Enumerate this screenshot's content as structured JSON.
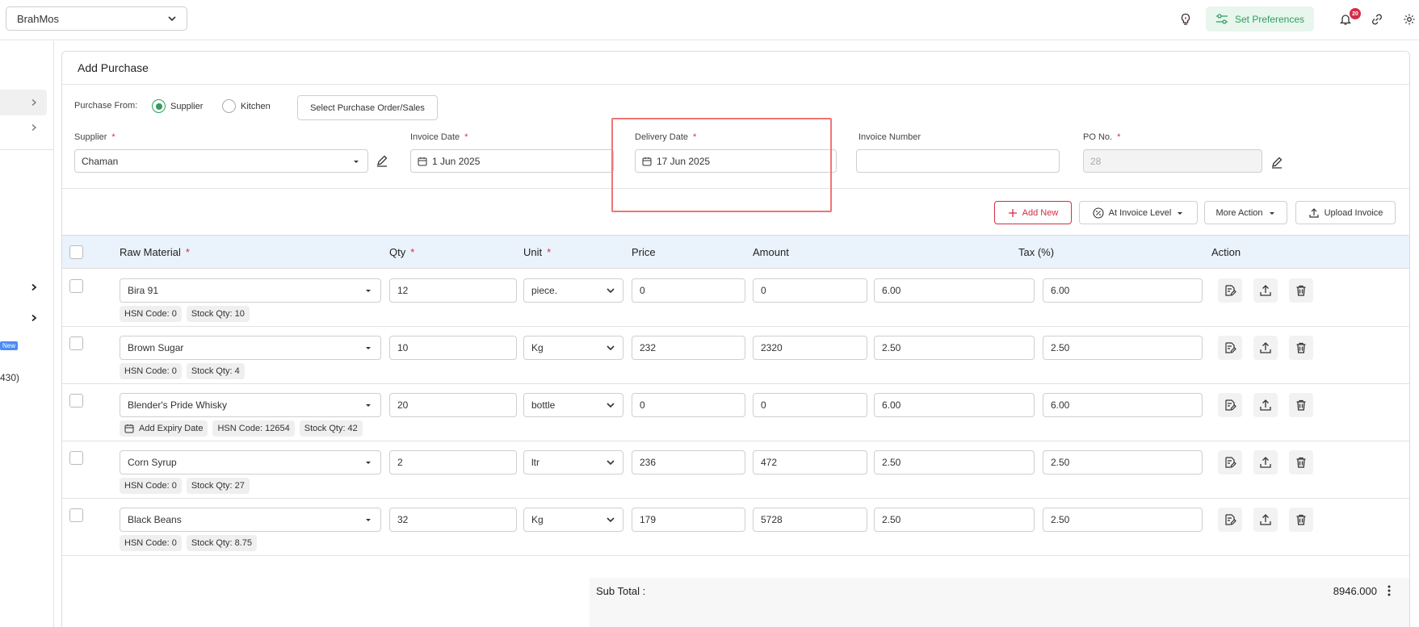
{
  "topbar": {
    "outlet": "BrahMos",
    "set_preferences": "Set Preferences",
    "notification_count": "20",
    "colors": {
      "accent": "#2e9e5e",
      "badge": "#d62b47"
    }
  },
  "sidebar": {
    "new_badge": "New",
    "partial_text": "430)"
  },
  "form": {
    "title": "Add Purchase",
    "purchase_from_label": "Purchase From:",
    "radio_supplier": "Supplier",
    "radio_kitchen": "Kitchen",
    "select_po_button": "Select Purchase Order/Sales",
    "supplier_label": "Supplier",
    "supplier_value": "Chaman",
    "invoice_date_label": "Invoice Date",
    "invoice_date_value": "1 Jun 2025",
    "delivery_date_label": "Delivery Date",
    "delivery_date_value": "17 Jun 2025",
    "invoice_number_label": "Invoice Number",
    "invoice_number_value": "",
    "po_no_label": "PO No.",
    "po_no_value": "28",
    "required_mark": "*"
  },
  "toolbar": {
    "add_new": "Add New",
    "invoice_level": "At Invoice Level",
    "more_action": "More Action",
    "upload_invoice": "Upload Invoice"
  },
  "table": {
    "headers": {
      "raw_material": "Raw Material",
      "qty": "Qty",
      "unit": "Unit",
      "price": "Price",
      "amount": "Amount",
      "tax": "Tax (%)",
      "action": "Action"
    },
    "rows": [
      {
        "material": "Bira 91",
        "qty": "12",
        "unit": "piece.",
        "price": "0",
        "amount": "0",
        "tax1": "6.00",
        "tax2": "6.00",
        "expiry": "",
        "hsn": "HSN Code: 0",
        "stock": "Stock Qty: 10"
      },
      {
        "material": "Brown Sugar",
        "qty": "10",
        "unit": "Kg",
        "price": "232",
        "amount": "2320",
        "tax1": "2.50",
        "tax2": "2.50",
        "expiry": "",
        "hsn": "HSN Code: 0",
        "stock": "Stock Qty: 4"
      },
      {
        "material": "Blender's Pride Whisky",
        "qty": "20",
        "unit": "bottle",
        "price": "0",
        "amount": "0",
        "tax1": "6.00",
        "tax2": "6.00",
        "expiry": "Add Expiry Date",
        "hsn": "HSN Code: 12654",
        "stock": "Stock Qty: 42"
      },
      {
        "material": "Corn Syrup",
        "qty": "2",
        "unit": "ltr",
        "price": "236",
        "amount": "472",
        "tax1": "2.50",
        "tax2": "2.50",
        "expiry": "",
        "hsn": "HSN Code: 0",
        "stock": "Stock Qty: 27"
      },
      {
        "material": "Black Beans",
        "qty": "32",
        "unit": "Kg",
        "price": "179",
        "amount": "5728",
        "tax1": "2.50",
        "tax2": "2.50",
        "expiry": "",
        "hsn": "HSN Code: 0",
        "stock": "Stock Qty: 8.75"
      }
    ]
  },
  "summary": {
    "subtotal_label": "Sub Total :",
    "subtotal_value": "8946.000"
  }
}
